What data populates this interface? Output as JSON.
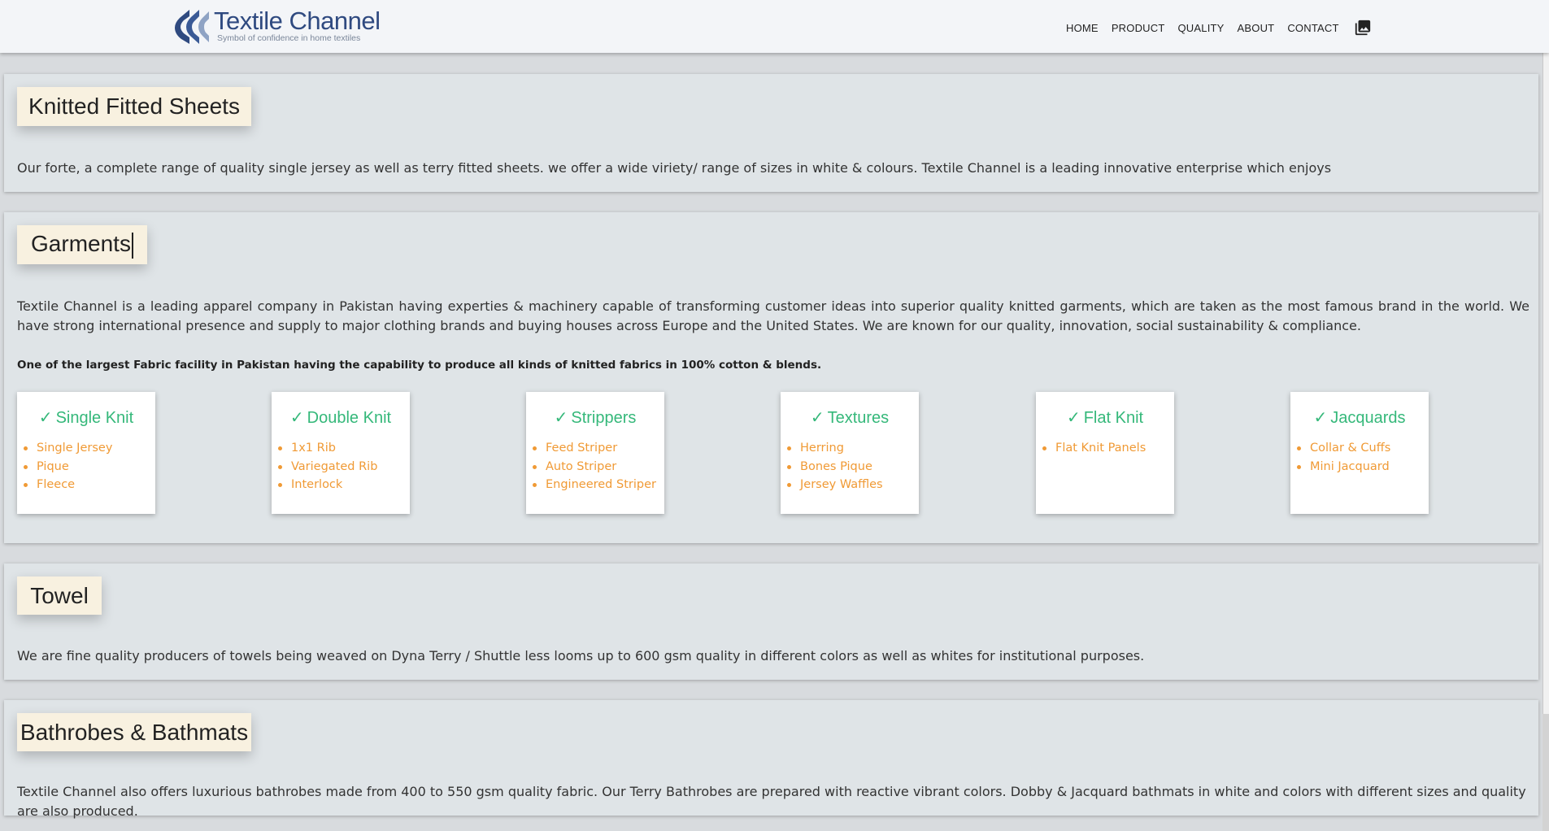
{
  "header": {
    "logo_title": "Textile Channel",
    "logo_tagline": "Symbol of confidence in home textiles",
    "nav": [
      {
        "label": "HOME"
      },
      {
        "label": "PRODUCT"
      },
      {
        "label": "QUALITY"
      },
      {
        "label": "ABOUT"
      },
      {
        "label": "CONTACT"
      }
    ],
    "gallery_icon": "photo-library-icon"
  },
  "sections": {
    "knitted": {
      "title": "Knitted Fitted Sheets",
      "text": "Our forte, a complete range of quality single jersey as well as terry fitted sheets. we offer a wide viriety/ range of sizes in white & colours. Textile Channel is a leading innovative enterprise which enjoys"
    },
    "garments": {
      "title": "Garments",
      "text": "Textile Channel is a leading apparel company in Pakistan having experties & machinery capable of transforming customer ideas into superior quality knitted garments, which are taken as the most famous brand in the world. We have strong international presence and supply to major clothing brands and buying houses across Europe and the United States. We are known for our quality, innovation, social sustainability & compliance.",
      "bold_line": "One of the largest Fabric facility in Pakistan having the capability to produce all kinds of knitted fabrics in 100% cotton & blends.",
      "check_mark": "✓",
      "cards": [
        {
          "title": "Single Knit",
          "items": [
            "Single Jersey",
            "Pique",
            "Fleece"
          ]
        },
        {
          "title": "Double Knit",
          "items": [
            "1x1 Rib",
            "Variegated Rib",
            "Interlock"
          ]
        },
        {
          "title": "Strippers",
          "items": [
            "Feed Striper",
            "Auto Striper",
            "Engineered Striper"
          ]
        },
        {
          "title": "Textures",
          "items": [
            "Herring",
            "Bones Pique",
            "Jersey Waffles"
          ]
        },
        {
          "title": "Flat Knit",
          "items": [
            "Flat Knit Panels"
          ]
        },
        {
          "title": "Jacquards",
          "items": [
            "Collar & Cuffs",
            "Mini Jacquard"
          ]
        }
      ]
    },
    "towel": {
      "title": "Towel",
      "text": "We are fine quality producers of towels being weaved on Dyna Terry / Shuttle less looms up to 600 gsm quality in different colors as well as whites for institutional purposes."
    },
    "bathrobes": {
      "title": "Bathrobes & Bathmats",
      "text": "Textile Channel also offers luxurious bathrobes made from 400 to 550 gsm quality fabric. Our Terry Bathrobes are prepared with reactive vibrant colors. Dobby & Jacquard bathmats in white and colors with different sizes and quality are also produced."
    }
  },
  "colors": {
    "accent_green": "#35b87a",
    "list_orange": "#f09a35",
    "title_bg": "#f8f1e0",
    "section_bg": "#dfe4e7"
  }
}
